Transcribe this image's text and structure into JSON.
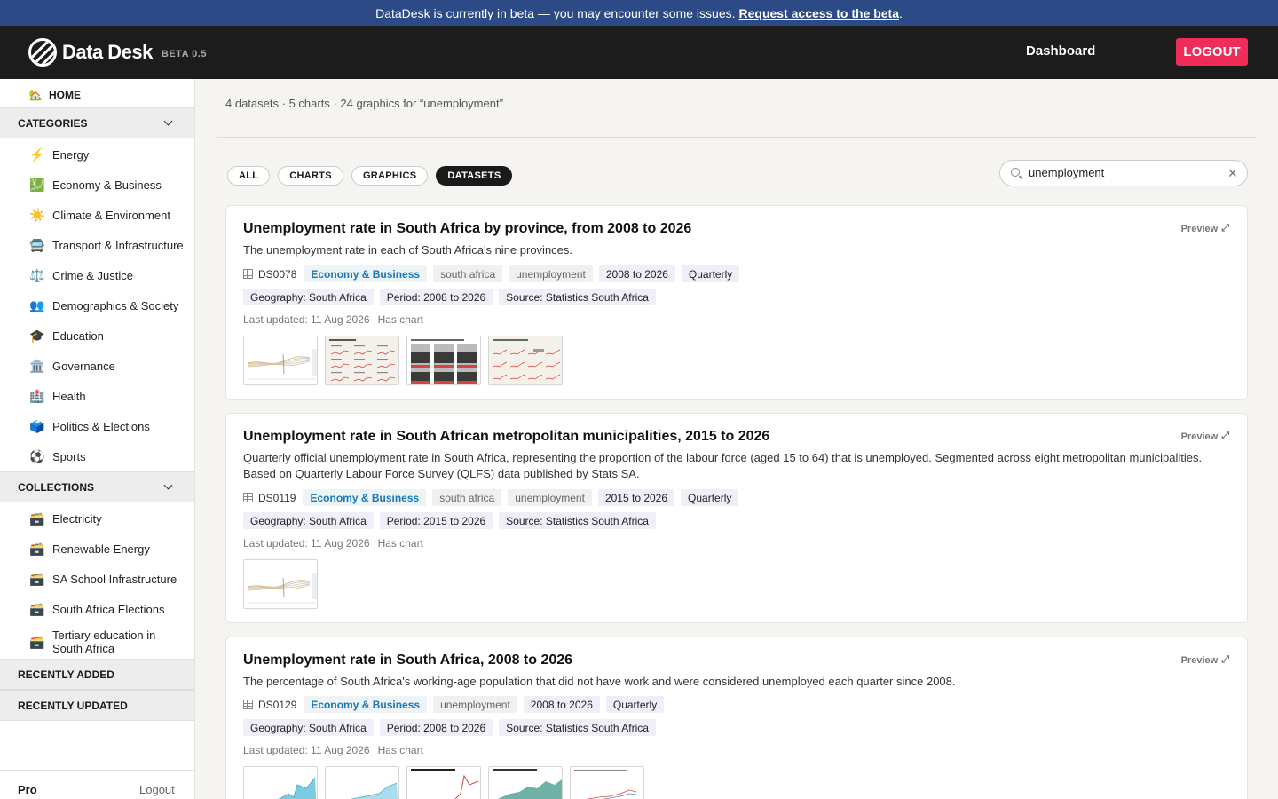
{
  "banner": {
    "text": "DataDesk is currently in beta — you may encounter some issues.",
    "link": "Request access to the beta",
    "trail": "."
  },
  "header": {
    "logo_text": "Data Desk",
    "beta_label": "BETA 0.5",
    "nav_dashboard": "Dashboard",
    "logout": "LOGOUT"
  },
  "sidebar": {
    "home": "HOME",
    "categories_title": "CATEGORIES",
    "categories": [
      {
        "label": "Energy",
        "icon": "⚡",
        "icon_name": "lightning-icon"
      },
      {
        "label": "Economy & Business",
        "icon": "💹",
        "icon_name": "chart-up-icon"
      },
      {
        "label": "Climate & Environment",
        "icon": "☀️",
        "icon_name": "sun-icon"
      },
      {
        "label": "Transport & Infrastructure",
        "icon": "🚍",
        "icon_name": "bus-icon"
      },
      {
        "label": "Crime & Justice",
        "icon": "⚖️",
        "icon_name": "scales-icon"
      },
      {
        "label": "Demographics & Society",
        "icon": "👥",
        "icon_name": "people-icon"
      },
      {
        "label": "Education",
        "icon": "🎓",
        "icon_name": "graduation-cap-icon"
      },
      {
        "label": "Governance",
        "icon": "🏛️",
        "icon_name": "government-building-icon"
      },
      {
        "label": "Health",
        "icon": "🏥",
        "icon_name": "hospital-icon"
      },
      {
        "label": "Politics & Elections",
        "icon": "🗳️",
        "icon_name": "ballot-box-icon"
      },
      {
        "label": "Sports",
        "icon": "⚽",
        "icon_name": "soccer-ball-icon"
      }
    ],
    "collections_title": "COLLECTIONS",
    "collections": [
      {
        "label": "Electricity",
        "icon": "🗃️",
        "icon_name": "box-icon"
      },
      {
        "label": "Renewable Energy",
        "icon": "🗃️",
        "icon_name": "box-icon"
      },
      {
        "label": "SA School Infrastructure",
        "icon": "🗃️",
        "icon_name": "box-icon"
      },
      {
        "label": "South Africa Elections",
        "icon": "🗃️",
        "icon_name": "box-icon"
      },
      {
        "label": "Tertiary education in South Africa",
        "icon": "🗃️",
        "icon_name": "box-icon"
      }
    ],
    "recently_added": "RECENTLY ADDED",
    "recently_updated": "RECENTLY UPDATED",
    "footer_plan": "Pro",
    "footer_logout": "Logout"
  },
  "search": {
    "summary_datasets": "4 datasets",
    "summary_charts": "· 5 charts",
    "summary_graphics": "· 24 graphics for “unemployment”",
    "query": "unemployment",
    "filters": [
      {
        "label": "ALL",
        "active": false
      },
      {
        "label": "CHARTS",
        "active": false
      },
      {
        "label": "GRAPHICS",
        "active": false
      },
      {
        "label": "DATASETS",
        "active": true
      }
    ]
  },
  "results": [
    {
      "title": "Unemployment rate in South Africa by province, from 2008 to 2026",
      "description": "The unemployment rate in each of South Africa's nine provinces.",
      "id": "DS0078",
      "category": "Economy & Business",
      "keywords": [
        "south africa",
        "unemployment"
      ],
      "period_tag": "2008 to 2026",
      "frequency": "Quarterly",
      "geography": "Geography: South Africa",
      "period": "Period: 2008 to 2026",
      "source": "Source: Statistics South Africa",
      "updated": "Last updated: 11 Aug 2026",
      "has_chart": "Has chart",
      "preview": "Preview"
    },
    {
      "title": "Unemployment rate in South African metropolitan municipalities, 2015 to 2026",
      "description": "Quarterly official unemployment rate in South Africa, representing the proportion of the labour force (aged 15 to 64) that is unemployed. Segmented across eight metropolitan municipalities. Based on Quarterly Labour Force Survey (QLFS) data published by Stats SA.",
      "id": "DS0119",
      "category": "Economy & Business",
      "keywords": [
        "south africa",
        "unemployment"
      ],
      "period_tag": "2015 to 2026",
      "frequency": "Quarterly",
      "geography": "Geography: South Africa",
      "period": "Period: 2015 to 2026",
      "source": "Source: Statistics South Africa",
      "updated": "Last updated: 11 Aug 2026",
      "has_chart": "Has chart",
      "preview": "Preview"
    },
    {
      "title": "Unemployment rate in South Africa, 2008 to 2026",
      "description": "The percentage of South Africa's working-age population that did not have work and were considered unemployed each quarter since 2008.",
      "id": "DS0129",
      "category": "Economy & Business",
      "keywords": [
        "unemployment"
      ],
      "period_tag": "2008 to 2026",
      "frequency": "Quarterly",
      "geography": "Geography: South Africa",
      "period": "Period: 2008 to 2026",
      "source": "Source: Statistics South Africa",
      "updated": "Last updated: 11 Aug 2026",
      "has_chart": "Has chart",
      "preview": "Preview"
    }
  ],
  "colors": {
    "banner": "#2c4a85",
    "header": "#1c1c1c",
    "logout": "#ee2e58",
    "category_tag": "#1778b9"
  }
}
